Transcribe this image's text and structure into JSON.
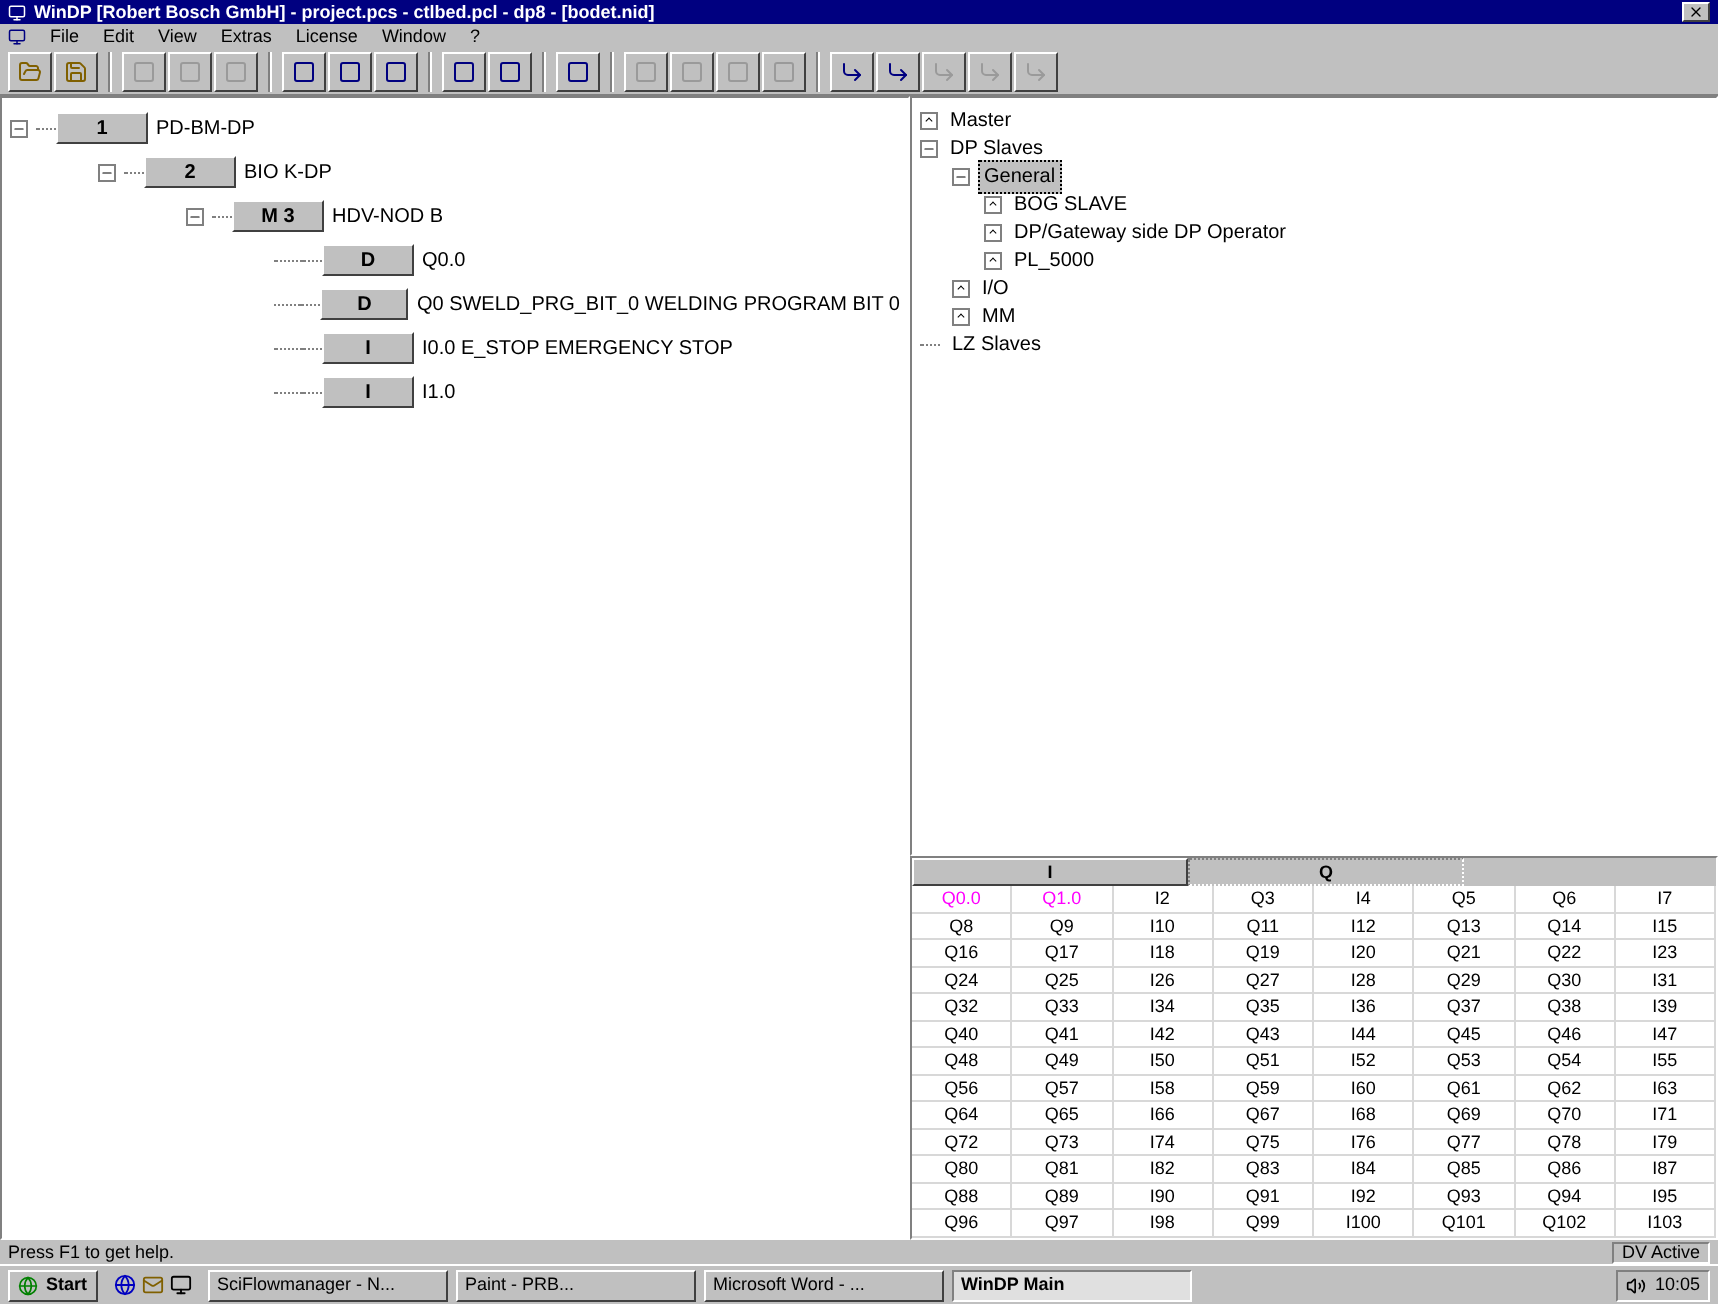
{
  "window": {
    "title": "WinDP [Robert Bosch GmbH] - project.pcs - ctlbed.pcl - dp8 - [bodet.nid]"
  },
  "menu": [
    "File",
    "Edit",
    "View",
    "Extras",
    "License",
    "Window",
    "?"
  ],
  "toolbar": [
    {
      "kind": "open"
    },
    {
      "kind": "save"
    },
    {
      "kind": "sep"
    },
    {
      "kind": "tool",
      "disabled": true
    },
    {
      "kind": "tool",
      "disabled": true
    },
    {
      "kind": "tool",
      "disabled": true
    },
    {
      "kind": "sep"
    },
    {
      "kind": "tool",
      "disabled": false
    },
    {
      "kind": "tool",
      "disabled": false
    },
    {
      "kind": "tool",
      "disabled": false
    },
    {
      "kind": "sep"
    },
    {
      "kind": "tool",
      "disabled": false
    },
    {
      "kind": "tool",
      "disabled": false
    },
    {
      "kind": "sep"
    },
    {
      "kind": "tool",
      "disabled": false
    },
    {
      "kind": "sep"
    },
    {
      "kind": "tool",
      "disabled": true
    },
    {
      "kind": "tool",
      "disabled": true
    },
    {
      "kind": "tool",
      "disabled": true
    },
    {
      "kind": "tool",
      "disabled": true
    },
    {
      "kind": "sep"
    },
    {
      "kind": "arrow",
      "disabled": false
    },
    {
      "kind": "arrow",
      "disabled": false
    },
    {
      "kind": "arrow",
      "disabled": true
    },
    {
      "kind": "arrow",
      "disabled": true
    },
    {
      "kind": "arrow",
      "disabled": true
    }
  ],
  "network_tree": [
    {
      "tag": "1",
      "label": "PD-BM-DP",
      "expanded": true,
      "children": [
        {
          "tag": "2",
          "label": "BIO K-DP",
          "expanded": true,
          "children": [
            {
              "tag": "M 3",
              "label": "HDV-NOD B",
              "expanded": true,
              "children": [
                {
                  "tag": "D",
                  "label": "Q0.0"
                },
                {
                  "tag": "D",
                  "label": "Q0 SWELD_PRG_BIT_0 WELDING PROGRAM BIT 0"
                },
                {
                  "tag": "I",
                  "label": "I0.0 E_STOP EMERGENCY STOP"
                },
                {
                  "tag": "I",
                  "label": "I1.0"
                }
              ]
            }
          ]
        }
      ]
    }
  ],
  "catalog_tree": [
    {
      "label": "Master",
      "expanded": false
    },
    {
      "label": "DP Slaves",
      "expanded": true,
      "children": [
        {
          "label": "General",
          "expanded": true,
          "selected": true,
          "children": [
            {
              "label": "BOG SLAVE",
              "expanded": false,
              "selected": false
            },
            {
              "label": "DP/Gateway side DP Operator",
              "expanded": false,
              "selected": false
            },
            {
              "label": "PL_5000",
              "expanded": false,
              "selected": false
            }
          ]
        },
        {
          "label": "I/O",
          "expanded": false,
          "selected": false
        },
        {
          "label": "MM",
          "expanded": false,
          "selected": false
        }
      ]
    },
    {
      "label": "LZ Slaves"
    }
  ],
  "io_tabs": [
    {
      "label": "I",
      "selected": false
    },
    {
      "label": "Q",
      "selected": true
    }
  ],
  "io_table": [
    {
      "cells": [
        "Q0.0",
        "Q1.0",
        "I2",
        "Q3",
        "I4",
        "Q5",
        "Q6",
        "I7"
      ],
      "highlighted": [
        true,
        true,
        false,
        false,
        false,
        false,
        false,
        false
      ]
    },
    {
      "cells": [
        "Q8",
        "Q9",
        "I10",
        "Q11",
        "I12",
        "Q13",
        "Q14",
        "I15"
      ]
    },
    {
      "cells": [
        "Q16",
        "Q17",
        "I18",
        "Q19",
        "I20",
        "Q21",
        "Q22",
        "I23"
      ]
    },
    {
      "cells": [
        "Q24",
        "Q25",
        "I26",
        "Q27",
        "I28",
        "Q29",
        "Q30",
        "I31"
      ]
    },
    {
      "cells": [
        "Q32",
        "Q33",
        "I34",
        "Q35",
        "I36",
        "Q37",
        "Q38",
        "I39"
      ]
    },
    {
      "cells": [
        "Q40",
        "Q41",
        "I42",
        "Q43",
        "I44",
        "Q45",
        "Q46",
        "I47"
      ]
    },
    {
      "cells": [
        "Q48",
        "Q49",
        "I50",
        "Q51",
        "I52",
        "Q53",
        "Q54",
        "I55"
      ]
    },
    {
      "cells": [
        "Q56",
        "Q57",
        "I58",
        "Q59",
        "I60",
        "Q61",
        "Q62",
        "I63"
      ]
    },
    {
      "cells": [
        "Q64",
        "Q65",
        "I66",
        "Q67",
        "I68",
        "Q69",
        "Q70",
        "I71"
      ]
    },
    {
      "cells": [
        "Q72",
        "Q73",
        "I74",
        "Q75",
        "I76",
        "Q77",
        "Q78",
        "I79"
      ]
    },
    {
      "cells": [
        "Q80",
        "Q81",
        "I82",
        "Q83",
        "I84",
        "Q85",
        "Q86",
        "I87"
      ]
    },
    {
      "cells": [
        "Q88",
        "Q89",
        "I90",
        "Q91",
        "I92",
        "Q93",
        "Q94",
        "I95"
      ]
    },
    {
      "cells": [
        "Q96",
        "Q97",
        "I98",
        "Q99",
        "I100",
        "Q101",
        "Q102",
        "I103"
      ]
    }
  ],
  "status_bar": {
    "message": "Press F1 to get help.",
    "mode": "DV Active"
  },
  "taskbar": {
    "start": "Start",
    "tasks": [
      {
        "label": "SciFlowmanager - N...",
        "selected": false
      },
      {
        "label": "Paint - PRB...",
        "selected": false
      },
      {
        "label": "Microsoft Word - ...",
        "selected": false
      },
      {
        "label": "WinDP Main",
        "selected": true
      }
    ],
    "clock": "10:05"
  }
}
